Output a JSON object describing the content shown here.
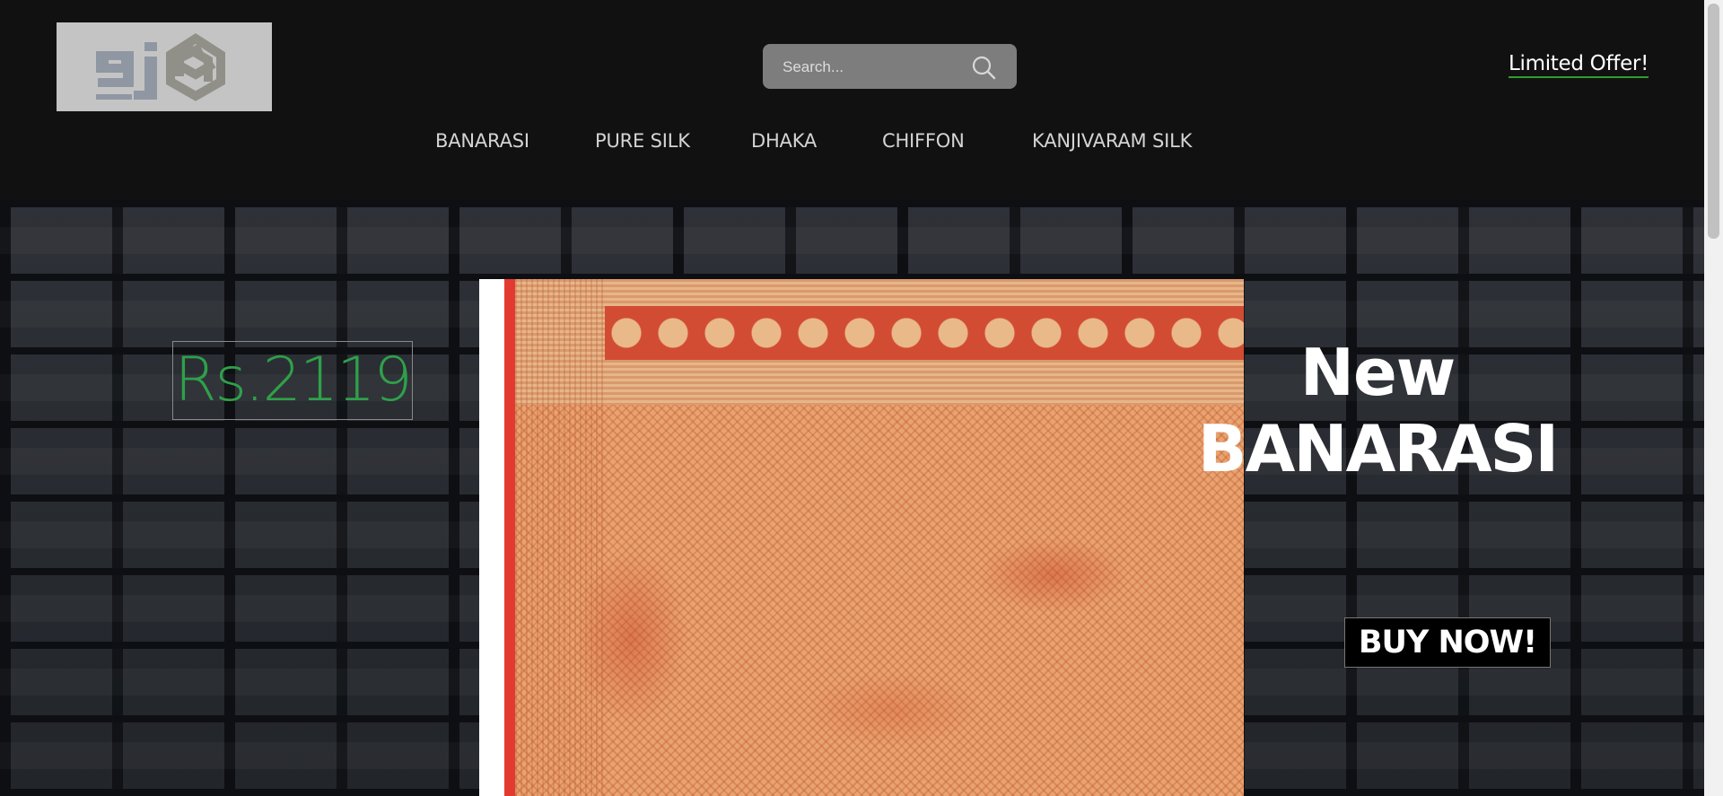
{
  "header": {
    "logo_text": "gj",
    "search": {
      "placeholder": "Search..."
    },
    "offer_link": "Limited Offer!"
  },
  "nav": {
    "items": [
      {
        "label": "BANARASI"
      },
      {
        "label": "PURE SILK"
      },
      {
        "label": "DHAKA"
      },
      {
        "label": "CHIFFON"
      },
      {
        "label": "KANJIVARAM SILK"
      }
    ]
  },
  "hero": {
    "price": "Rs.2119",
    "headline_line1": "New",
    "headline_line2": "BANARASI",
    "cta_label": "BUY NOW!"
  },
  "colors": {
    "header_bg": "#111111",
    "price_text": "#2fa04a",
    "offer_underline": "#2f9d2f",
    "search_bg": "#7d7d7d"
  },
  "icons": {
    "search": "search-icon",
    "logo_mark": "hexagon-knot-icon"
  }
}
